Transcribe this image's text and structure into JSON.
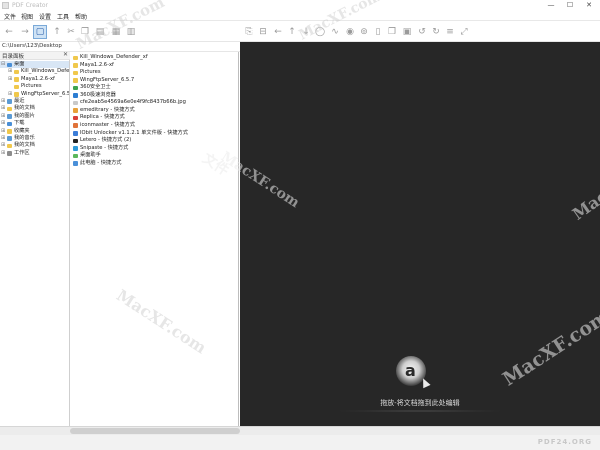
{
  "window": {
    "title": "PDF Creator",
    "controls": {
      "minimize": "—",
      "maximize": "☐",
      "close": "✕"
    }
  },
  "menu": [
    "文件",
    "视图",
    "设置",
    "工具",
    "帮助"
  ],
  "toolbar": {
    "left_icons": [
      "back-icon",
      "forward-icon",
      "folder-icon",
      "up-arrow-icon",
      "cut-icon",
      "copy-icon",
      "paste-icon",
      "grid-view-icon",
      "delete-icon"
    ],
    "right_icons": [
      "new-page-icon",
      "save-icon",
      "arrow-left-icon",
      "arrow-up-icon",
      "arrow-down-icon",
      "ocr-icon",
      "wave-icon",
      "eye-icon",
      "search-doc-icon",
      "doc-icon",
      "copy-doc-icon",
      "delete-doc-icon",
      "rotate-left-icon",
      "rotate-right-icon",
      "list-icon",
      "fullscreen-icon"
    ]
  },
  "path": "C:\\Users\\123\\Desktop",
  "tree_panel": {
    "header": "目录面板",
    "close": "✕",
    "items": [
      {
        "label": "桌面",
        "indent": 1,
        "exp": "⊟",
        "color": "#4a8fd6",
        "selected": true
      },
      {
        "label": "Kill_Windows_Defender_v",
        "indent": 2,
        "exp": "⊞",
        "color": "#f0c84c"
      },
      {
        "label": "Maya1.2.6-xf",
        "indent": 2,
        "exp": "⊞",
        "color": "#f0c84c"
      },
      {
        "label": "Pictures",
        "indent": 2,
        "exp": "",
        "color": "#f0c84c"
      },
      {
        "label": "WingFtpServer_6.5.7",
        "indent": 2,
        "exp": "⊞",
        "color": "#f0c84c"
      },
      {
        "label": "最近",
        "indent": 1,
        "exp": "⊞",
        "color": "#5b9bd5"
      },
      {
        "label": "我的文档",
        "indent": 1,
        "exp": "⊞",
        "color": "#f0c84c"
      },
      {
        "label": "我的图片",
        "indent": 1,
        "exp": "⊞",
        "color": "#5b9bd5"
      },
      {
        "label": "下载",
        "indent": 1,
        "exp": "⊞",
        "color": "#4a8fd6"
      },
      {
        "label": "收藏夹",
        "indent": 1,
        "exp": "⊞",
        "color": "#f0c84c"
      },
      {
        "label": "我的音乐",
        "indent": 1,
        "exp": "⊞",
        "color": "#5b9bd5"
      },
      {
        "label": "我的文档",
        "indent": 1,
        "exp": "⊞",
        "color": "#f0c84c"
      },
      {
        "label": "工作区",
        "indent": 1,
        "exp": "⊞",
        "color": "#8c8c8c"
      }
    ]
  },
  "files": [
    {
      "name": "Kill_Windows_Defender_xf",
      "color": "#f0c84c"
    },
    {
      "name": "Maya1.2.6-xf",
      "color": "#f0c84c"
    },
    {
      "name": "Pictures",
      "color": "#f0c84c"
    },
    {
      "name": "WingFtpServer_6.5.7",
      "color": "#f0c84c"
    },
    {
      "name": "360安全卫士",
      "color": "#3fa34d"
    },
    {
      "name": "360极速浏览器",
      "color": "#2d7dd2"
    },
    {
      "name": "cfe2eab5e4569a6e0e4f9fc8437b66b.jpg",
      "color": "#c9c9c9"
    },
    {
      "name": "emeditrary - 快捷方式",
      "color": "#e8a13a"
    },
    {
      "name": "Replica - 快捷方式",
      "color": "#d9403a"
    },
    {
      "name": "iconmaster - 快捷方式",
      "color": "#e0733a"
    },
    {
      "name": "IObit Unlocker v1.1.2.1 单文件版 - 快捷方式",
      "color": "#3b7dd8"
    },
    {
      "name": "Letero - 快捷方式 (2)",
      "color": "#222222"
    },
    {
      "name": "Snipaste - 快捷方式",
      "color": "#2f9ad8"
    },
    {
      "name": "桌面助手",
      "color": "#5bb75b"
    },
    {
      "name": "此电脑 - 快捷方式",
      "color": "#4a90d9"
    }
  ],
  "preview": {
    "drop_text": "拖放-将文档拖到此处编辑",
    "icon": "document-drop-icon",
    "glyph": "a"
  },
  "status": {
    "logo": "PDF24.ORG"
  },
  "watermarks": {
    "cn": "文件",
    "brand": "MacXF.com"
  }
}
